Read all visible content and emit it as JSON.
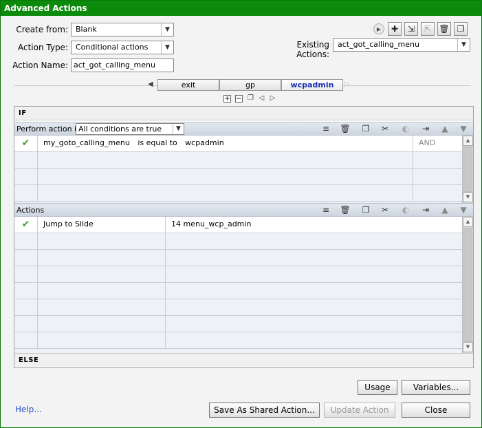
{
  "window": {
    "title": "Advanced Actions"
  },
  "form": {
    "create_from_label": "Create from:",
    "create_from_value": "Blank",
    "action_type_label": "Action Type:",
    "action_type_value": "Conditional actions",
    "action_name_label": "Action Name:",
    "action_name_value": "act_got_calling_menu",
    "existing_actions_label": "Existing Actions:",
    "existing_actions_value": "act_got_calling_menu"
  },
  "tabs": [
    {
      "label": "exit"
    },
    {
      "label": "gp"
    },
    {
      "label": "wcpadmin",
      "active": true
    }
  ],
  "if_section": {
    "label": "IF",
    "perform_label": "Perform action if:",
    "perform_value": "All conditions are true",
    "conditions": [
      {
        "status": "✔",
        "variable": "my_goto_calling_menu",
        "operator": "is equal to",
        "value": "wcpadmin",
        "logic": "AND"
      }
    ]
  },
  "actions_section": {
    "label": "Actions",
    "rows": [
      {
        "status": "✔",
        "action": "Jump to Slide",
        "target": "14 menu_wcp_admin"
      }
    ]
  },
  "else_section": {
    "label": "ELSE"
  },
  "buttons": {
    "usage": "Usage",
    "variables": "Variables...",
    "help": "Help...",
    "save_shared": "Save As Shared Action...",
    "update": "Update Action",
    "close": "Close"
  },
  "colors": {
    "title_bar": "#0b8a0b",
    "check": "#3aa02a",
    "active_tab": "#1a2fb0",
    "link": "#2050c0"
  }
}
